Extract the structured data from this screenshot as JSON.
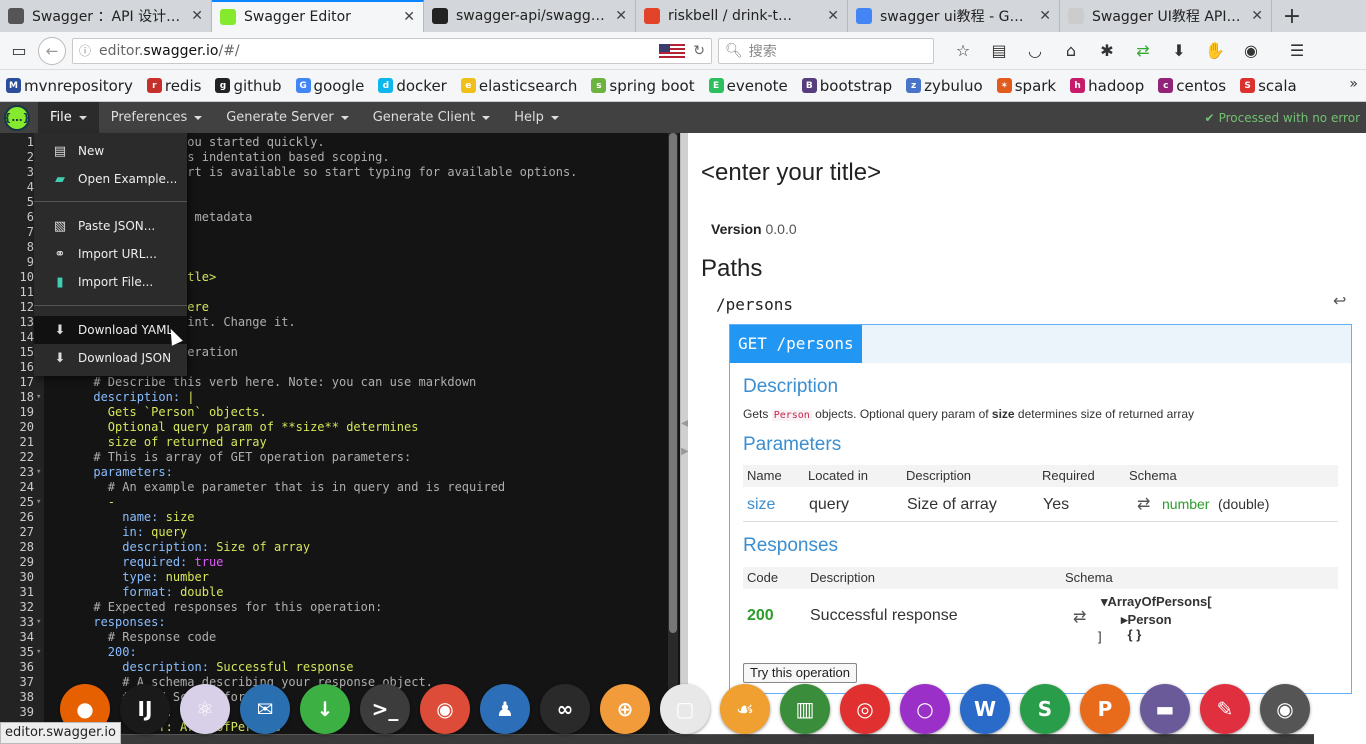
{
  "browser": {
    "tabs": [
      {
        "title": "Swagger ：API 设计…",
        "favicon_color": "#555555",
        "favicon": "gear-icon"
      },
      {
        "title": "Swagger Editor",
        "favicon_color": "#85ea2d",
        "favicon": "swagger-icon",
        "active": true
      },
      {
        "title": "swagger-api/swagge…",
        "favicon_color": "#222222",
        "favicon": "github-icon"
      },
      {
        "title": "riskbell / drink-t…",
        "favicon_color": "#e24329",
        "favicon": "gitlab-icon"
      },
      {
        "title": "swagger ui教程 - G…",
        "favicon_color": "#4285f4",
        "favicon": "google-icon"
      },
      {
        "title": "Swagger UI教程 API 文…",
        "favicon_color": "#cccccc",
        "favicon": "page-icon"
      }
    ],
    "close_glyph": "✕",
    "new_tab_glyph": "+",
    "url_prefix": "editor.",
    "url_domain": "swagger.io",
    "url_suffix": "/#/",
    "search_placeholder": "搜索"
  },
  "bookmarks": [
    {
      "label": "mvnrepository",
      "color": "#2b4e9a",
      "glyph": "M"
    },
    {
      "label": "redis",
      "color": "#c6302b",
      "glyph": "r"
    },
    {
      "label": "github",
      "color": "#222222",
      "glyph": "g"
    },
    {
      "label": "google",
      "color": "#4285f4",
      "glyph": "G"
    },
    {
      "label": "docker",
      "color": "#0db7ed",
      "glyph": "d"
    },
    {
      "label": "elasticsearch",
      "color": "#f0bf1a",
      "glyph": "e"
    },
    {
      "label": "spring boot",
      "color": "#6db33f",
      "glyph": "s"
    },
    {
      "label": "evenote",
      "color": "#2dbe60",
      "glyph": "E"
    },
    {
      "label": "bootstrap",
      "color": "#563d7c",
      "glyph": "B"
    },
    {
      "label": "zybuluo",
      "color": "#4a74c9",
      "glyph": "z"
    },
    {
      "label": "spark",
      "color": "#e25a1c",
      "glyph": "✶"
    },
    {
      "label": "hadoop",
      "color": "#c51b6a",
      "glyph": "h"
    },
    {
      "label": "centos",
      "color": "#932279",
      "glyph": "c"
    },
    {
      "label": "scala",
      "color": "#dc322f",
      "glyph": "S"
    }
  ],
  "swagger_bar": {
    "menus": [
      "File",
      "Preferences",
      "Generate Server",
      "Generate Client",
      "Help"
    ],
    "processed": "Processed with no error"
  },
  "file_menu": [
    {
      "label": "New",
      "icon": "new-file-icon"
    },
    {
      "label": "Open Example...",
      "icon": "folder-open-icon"
    },
    {
      "label": "Paste JSON...",
      "icon": "paste-icon"
    },
    {
      "label": "Import URL...",
      "icon": "link-icon"
    },
    {
      "label": "Import File...",
      "icon": "file-icon"
    },
    {
      "label": "Download YAML",
      "icon": "download-icon"
    },
    {
      "label": "Download JSON",
      "icon": "download-icon"
    }
  ],
  "editor": {
    "lines": [
      {
        "n": "1",
        "text": "et you started quickly.",
        "cls": "cm",
        "indent": "               "
      },
      {
        "n": "2",
        "text": "L has indentation based scoping.",
        "cls": "cm",
        "indent": "               "
      },
      {
        "n": "3",
        "text": "upport is available so start typing for available options.",
        "cls": "cm",
        "indent": "               "
      },
      {
        "n": "4",
        "text": "",
        "cls": "cm",
        "indent": ""
      },
      {
        "n": "5",
        "text": "",
        "cls": "cm",
        "indent": ""
      },
      {
        "n": "6",
        "text": "ment metadata",
        "cls": "cm",
        "indent": "               "
      },
      {
        "n": "7",
        "text": "",
        "cls": "cm",
        "indent": ""
      },
      {
        "n": "8",
        "text": "",
        "cls": "cm",
        "indent": ""
      },
      {
        "n": "9",
        "text": "",
        "cls": "cm",
        "indent": ""
      },
      {
        "n": "10",
        "text": "r title>",
        "cls": "st",
        "indent": "               "
      },
      {
        "n": "11",
        "text": "",
        "cls": "cm",
        "indent": ""
      },
      {
        "n": "12",
        "text": "ns here",
        "cls": "st",
        "indent": "               "
      },
      {
        "n": "13",
        "text": "ndpoint. Change it.",
        "cls": "cm",
        "indent": "               "
      },
      {
        "n": "14",
        "text": "",
        "cls": "cm",
        "indent": ""
      },
      {
        "n": "15",
        "text": "D operation",
        "cls": "cm",
        "indent": "               "
      },
      {
        "n": "16",
        "text": "",
        "cls": "cm",
        "indent": ""
      },
      {
        "n": "17",
        "text": "# Describe this verb here. Note: you can use markdown",
        "cls": "cm",
        "indent": "      "
      },
      {
        "n": "18",
        "key": "description",
        "val": " |",
        "cls": "ky",
        "indent": "      ",
        "fold": true
      },
      {
        "n": "19",
        "text": "Gets `Person` objects.",
        "cls": "st",
        "indent": "        "
      },
      {
        "n": "20",
        "text": "Optional query param of **size** determines",
        "cls": "st",
        "indent": "        "
      },
      {
        "n": "21",
        "text": "size of returned array",
        "cls": "st",
        "indent": "        "
      },
      {
        "n": "22",
        "text": "# This is array of GET operation parameters:",
        "cls": "cm",
        "indent": "      "
      },
      {
        "n": "23",
        "key": "parameters",
        "val": "",
        "cls": "ky",
        "indent": "      ",
        "fold": true
      },
      {
        "n": "24",
        "text": "# An example parameter that is in query and is required",
        "cls": "cm",
        "indent": "        "
      },
      {
        "n": "25",
        "text": "-",
        "cls": "st",
        "indent": "        ",
        "fold": true
      },
      {
        "n": "26",
        "key": "name",
        "val": " size",
        "cls": "ky",
        "indent": "          "
      },
      {
        "n": "27",
        "key": "in",
        "val": " query",
        "cls": "ky",
        "indent": "          "
      },
      {
        "n": "28",
        "key": "description",
        "val": " Size of array",
        "cls": "ky",
        "indent": "          "
      },
      {
        "n": "29",
        "key": "required",
        "val": " true",
        "cls": "ky",
        "indent": "          ",
        "bool": true
      },
      {
        "n": "30",
        "key": "type",
        "val": " number",
        "cls": "ky",
        "indent": "          "
      },
      {
        "n": "31",
        "key": "format",
        "val": " double",
        "cls": "ky",
        "indent": "          "
      },
      {
        "n": "32",
        "text": "# Expected responses for this operation:",
        "cls": "cm",
        "indent": "      "
      },
      {
        "n": "33",
        "key": "responses",
        "val": "",
        "cls": "ky",
        "indent": "      ",
        "fold": true
      },
      {
        "n": "34",
        "text": "# Response code",
        "cls": "cm",
        "indent": "        "
      },
      {
        "n": "35",
        "key": "200",
        "val": "",
        "cls": "ky",
        "indent": "        ",
        "fold": true
      },
      {
        "n": "36",
        "key": "description",
        "val": " Successful response",
        "cls": "ky",
        "indent": "          "
      },
      {
        "n": "37",
        "text": "# A schema describing your response object.",
        "cls": "cm",
        "indent": "          "
      },
      {
        "n": "38",
        "text": "# JSON Schema format",
        "cls": "cm",
        "indent": "          "
      },
      {
        "n": "39",
        "key": "schema",
        "val": "",
        "cls": "ky",
        "indent": "          "
      },
      {
        "n": "40",
        "text": "$ref: ArrayOfPersons",
        "cls": "st",
        "indent": "            "
      }
    ]
  },
  "preview": {
    "title": "<enter your title>",
    "version_label": "Version",
    "version_value": "0.0.0",
    "paths_heading": "Paths",
    "path": "/persons",
    "op_badge": "GET /persons",
    "description_heading": "Description",
    "desc_pre": "Gets ",
    "desc_code": "Person",
    "desc_mid": " objects. Optional query param of ",
    "desc_bold": "size",
    "desc_post": " determines size of returned array",
    "parameters_heading": "Parameters",
    "param_headers": [
      "Name",
      "Located in",
      "Description",
      "Required",
      "Schema"
    ],
    "param_row": {
      "name": "size",
      "in": "query",
      "description": "Size of array",
      "required": "Yes",
      "schema_type": "number",
      "schema_format": "(double)"
    },
    "responses_heading": "Responses",
    "resp_headers": [
      "Code",
      "Description",
      "Schema"
    ],
    "resp_row": {
      "code": "200",
      "description": "Successful response",
      "schema_line1": "ArrayOfPersons[",
      "schema_line2": "Person { }",
      "schema_close": "]"
    },
    "try_button": "Try this operation"
  },
  "dock": [
    {
      "name": "firefox",
      "color": "#e66000",
      "glyph": "●"
    },
    {
      "name": "intellij",
      "color": "#1a1a1a",
      "glyph": "IJ"
    },
    {
      "name": "atom",
      "color": "#d8d0e8",
      "glyph": "⚛"
    },
    {
      "name": "thunderbird",
      "color": "#2a6fb0",
      "glyph": "✉"
    },
    {
      "name": "download",
      "color": "#3cb043",
      "glyph": "↓"
    },
    {
      "name": "terminal",
      "color": "#3c3c3c",
      "glyph": ">_"
    },
    {
      "name": "chrome",
      "color": "#dd4b39",
      "glyph": "◉"
    },
    {
      "name": "qq",
      "color": "#2c6fb8",
      "glyph": "♟"
    },
    {
      "name": "network",
      "color": "#2a2a2a",
      "glyph": "∞"
    },
    {
      "name": "store",
      "color": "#f19b3b",
      "glyph": "⊕"
    },
    {
      "name": "virtualbox",
      "color": "#e8e8e8",
      "glyph": "▢"
    },
    {
      "name": "mysql",
      "color": "#f0a030",
      "glyph": "☙"
    },
    {
      "name": "reader",
      "color": "#3a8d3a",
      "glyph": "▥"
    },
    {
      "name": "netease-music",
      "color": "#e03030",
      "glyph": "◎"
    },
    {
      "name": "circle-app",
      "color": "#9b30c8",
      "glyph": "○"
    },
    {
      "name": "wps-writer",
      "color": "#2a6ac8",
      "glyph": "W"
    },
    {
      "name": "wps-sheet",
      "color": "#2a9d4a",
      "glyph": "S"
    },
    {
      "name": "wps-presentation",
      "color": "#e86b1c",
      "glyph": "P"
    },
    {
      "name": "files",
      "color": "#6a5a9a",
      "glyph": "▬"
    },
    {
      "name": "pen-app",
      "color": "#e03040",
      "glyph": "✎"
    },
    {
      "name": "camera",
      "color": "#555555",
      "glyph": "◉"
    }
  ],
  "status_url": "editor.swagger.io"
}
